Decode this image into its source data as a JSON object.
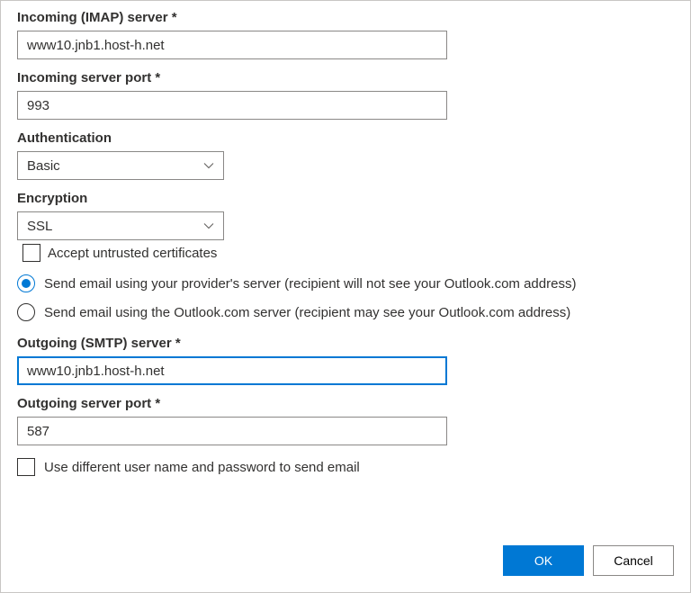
{
  "incoming_server": {
    "label": "Incoming (IMAP) server *",
    "value": "www10.jnb1.host-h.net"
  },
  "incoming_port": {
    "label": "Incoming server port *",
    "value": "993"
  },
  "authentication": {
    "label": "Authentication",
    "value": "Basic"
  },
  "encryption": {
    "label": "Encryption",
    "value": "SSL"
  },
  "accept_untrusted": {
    "label": "Accept untrusted certificates",
    "checked": false
  },
  "send_route": {
    "option_provider": "Send email using your provider's server (recipient will not see your Outlook.com address)",
    "option_outlook": "Send email using the Outlook.com server (recipient may see your Outlook.com address)",
    "selected": "provider"
  },
  "outgoing_server": {
    "label": "Outgoing (SMTP) server *",
    "value": "www10.jnb1.host-h.net"
  },
  "outgoing_port": {
    "label": "Outgoing server port *",
    "value": "587"
  },
  "use_different_creds": {
    "label": "Use different user name and password to send email",
    "checked": false
  },
  "buttons": {
    "ok": "OK",
    "cancel": "Cancel"
  }
}
